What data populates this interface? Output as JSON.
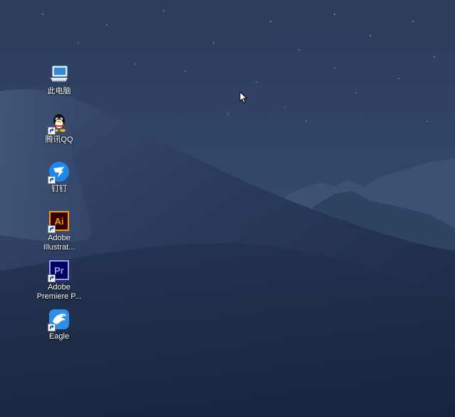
{
  "desktop": {
    "icons": [
      {
        "name": "this-pc",
        "label": "此电脑",
        "icon": "computer-icon",
        "shortcut": false
      },
      {
        "name": "tencent-qq",
        "label": "腾讯QQ",
        "icon": "qq-penguin-icon",
        "shortcut": true
      },
      {
        "name": "dingtalk",
        "label": "钉钉",
        "icon": "dingtalk-icon",
        "shortcut": true
      },
      {
        "name": "adobe-illustrator",
        "label_line1": "Adobe",
        "label_line2": "Illustrat...",
        "icon": "illustrator-icon",
        "icon_text": "Ai",
        "shortcut": true
      },
      {
        "name": "adobe-premiere",
        "label_line1": "Adobe",
        "label_line2": "Premiere P...",
        "icon": "premiere-icon",
        "icon_text": "Pr",
        "shortcut": true
      },
      {
        "name": "eagle",
        "label": "Eagle",
        "icon": "eagle-icon",
        "shortcut": true
      }
    ]
  },
  "colors": {
    "sky_top": "#2a3b5a",
    "dune_dark": "#1c2945",
    "illustrator_orange": "#ff9a00",
    "illustrator_bg": "#330000",
    "premiere_purple": "#9999ff",
    "premiere_bg": "#00005b",
    "dingtalk_blue": "#1e88f0",
    "eagle_blue": "#2f8fe8"
  }
}
